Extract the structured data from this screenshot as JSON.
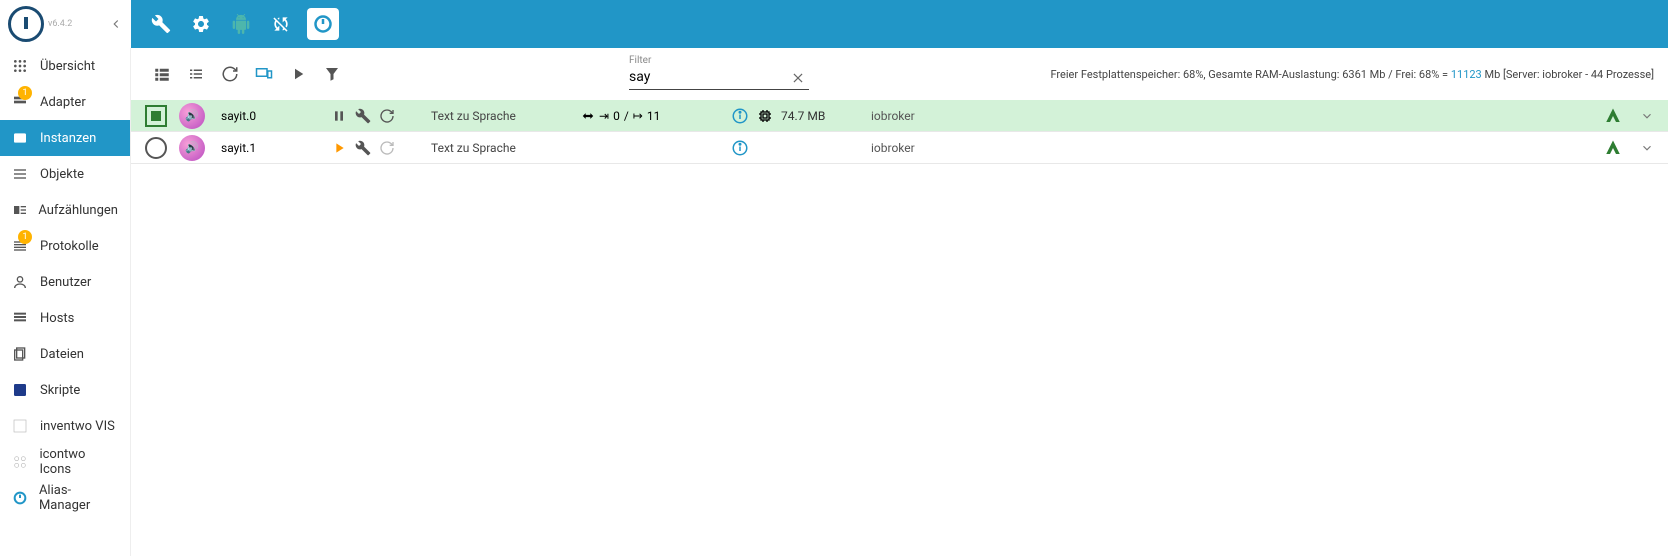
{
  "version": "v6.4.2",
  "sidebar": {
    "items": [
      {
        "label": "Übersicht",
        "badge": null
      },
      {
        "label": "Adapter",
        "badge": "1"
      },
      {
        "label": "Instanzen",
        "badge": null,
        "active": true
      },
      {
        "label": "Objekte",
        "badge": null
      },
      {
        "label": "Aufzählungen",
        "badge": null
      },
      {
        "label": "Protokolle",
        "badge": "1"
      },
      {
        "label": "Benutzer",
        "badge": null
      },
      {
        "label": "Hosts",
        "badge": null
      },
      {
        "label": "Dateien",
        "badge": null
      },
      {
        "label": "Skripte",
        "badge": null
      },
      {
        "label": "inventwo VIS",
        "badge": null
      },
      {
        "label": "icontwo Icons",
        "badge": null
      },
      {
        "label": "Alias-Manager",
        "badge": null
      }
    ]
  },
  "filter": {
    "label": "Filter",
    "value": "say"
  },
  "status_text": {
    "prefix": "Freier Festplattenspeicher: 68%, Gesamte RAM-Auslastung: 6361 Mb / Frei: 68% = ",
    "highlight": "11123",
    "suffix": " Mb [Server: iobroker - 44 Prozesse]"
  },
  "instances": [
    {
      "name": "sayit.0",
      "desc": "Text zu Sprache",
      "running": true,
      "conn_in": "0",
      "conn_out": "11",
      "mem": "74.7 MB",
      "host": "iobroker",
      "show_mem": true,
      "play_orange": false
    },
    {
      "name": "sayit.1",
      "desc": "Text zu Sprache",
      "running": false,
      "conn_in": "",
      "conn_out": "",
      "mem": "",
      "host": "iobroker",
      "show_mem": false,
      "play_orange": true
    }
  ]
}
